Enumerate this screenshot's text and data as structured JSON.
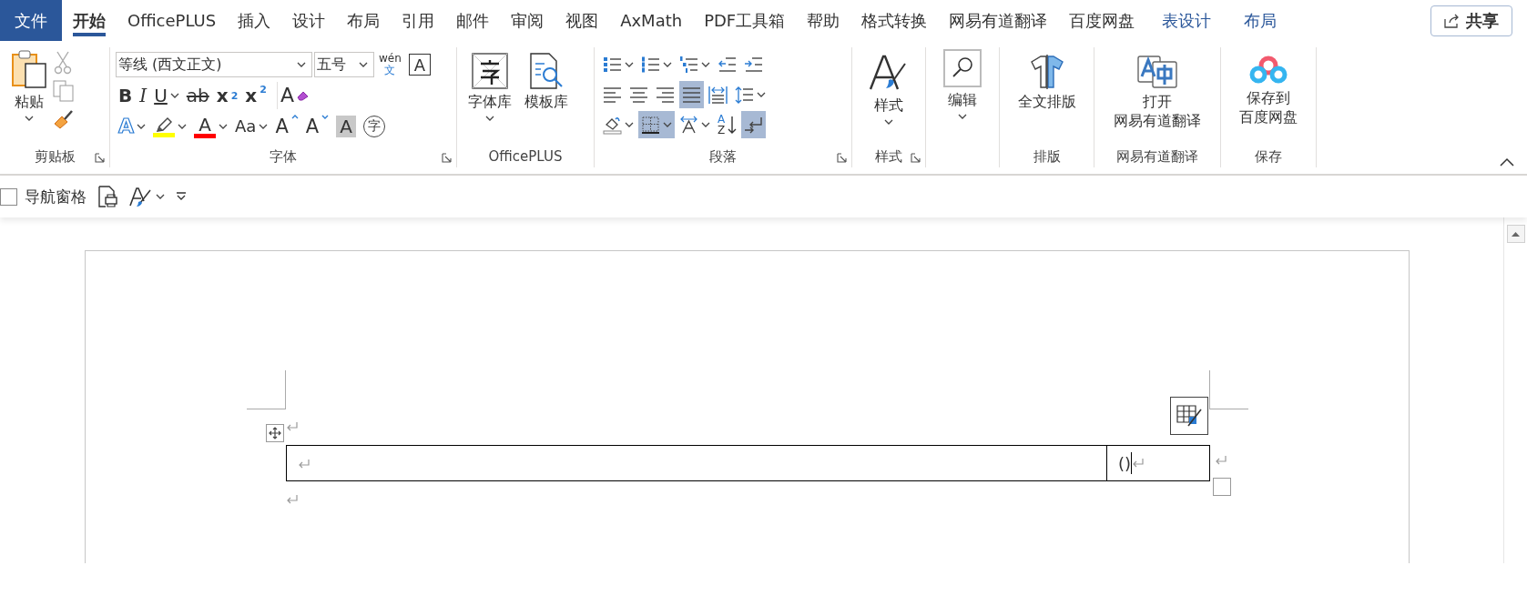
{
  "tabs": [
    {
      "label": "文件",
      "kind": "file",
      "selected": false
    },
    {
      "label": "开始",
      "kind": "main",
      "selected": true
    },
    {
      "label": "OfficePLUS",
      "kind": "main",
      "selected": false
    },
    {
      "label": "插入",
      "kind": "main",
      "selected": false
    },
    {
      "label": "设计",
      "kind": "main",
      "selected": false
    },
    {
      "label": "布局",
      "kind": "main",
      "selected": false
    },
    {
      "label": "引用",
      "kind": "main",
      "selected": false
    },
    {
      "label": "邮件",
      "kind": "main",
      "selected": false
    },
    {
      "label": "审阅",
      "kind": "main",
      "selected": false
    },
    {
      "label": "视图",
      "kind": "main",
      "selected": false
    },
    {
      "label": "AxMath",
      "kind": "main",
      "selected": false
    },
    {
      "label": "PDF工具箱",
      "kind": "main",
      "selected": false
    },
    {
      "label": "帮助",
      "kind": "main",
      "selected": false
    },
    {
      "label": "格式转换",
      "kind": "main",
      "selected": false
    },
    {
      "label": "网易有道翻译",
      "kind": "main",
      "selected": false
    },
    {
      "label": "百度网盘",
      "kind": "main",
      "selected": false
    },
    {
      "label": "表设计",
      "kind": "context",
      "selected": false
    },
    {
      "label": "布局",
      "kind": "context",
      "selected": false
    }
  ],
  "share_button": {
    "label": "共享"
  },
  "clipboard": {
    "paste": "粘贴",
    "label": "剪贴板"
  },
  "font": {
    "name": "等线 (西文正文)",
    "size": "五号",
    "phonetic_top": "wén",
    "phonetic_bottom": "文",
    "border_glyph": "A",
    "clear_glyph": "A",
    "label": "字体",
    "format_buttons": [
      {
        "glyph": "B",
        "kind": "bold",
        "dropdown": false
      },
      {
        "glyph": "I",
        "kind": "italic",
        "dropdown": false
      },
      {
        "glyph": "U",
        "kind": "underline",
        "dropdown": true
      },
      {
        "glyph": "ab",
        "kind": "strike",
        "dropdown": false
      },
      {
        "glyph": "x",
        "mark": "2",
        "kind": "subscript",
        "dropdown": false
      },
      {
        "glyph": "x",
        "mark": "2",
        "kind": "superscript",
        "dropdown": false
      }
    ],
    "color_buttons": [
      {
        "glyph": "A",
        "kind": "effects",
        "dropdown": true
      },
      {
        "kind": "highlight",
        "color": "#ffff00",
        "dropdown": true
      },
      {
        "glyph": "A",
        "kind": "font-color",
        "color": "#ff0000",
        "dropdown": true
      },
      {
        "glyph": "Aa",
        "kind": "case",
        "dropdown": true
      },
      {
        "glyph": "A",
        "kind": "grow",
        "dropdown": false
      },
      {
        "glyph": "A",
        "kind": "shrink",
        "dropdown": false
      },
      {
        "glyph": "A",
        "kind": "shading",
        "dropdown": false
      },
      {
        "glyph": "字",
        "kind": "enclose",
        "dropdown": false
      }
    ]
  },
  "officeplus": {
    "label": "OfficePLUS",
    "buttons": [
      {
        "label": "字体库",
        "kind": "font-library",
        "dropdown": true
      },
      {
        "label": "模板库",
        "kind": "template-library",
        "dropdown": false
      }
    ]
  },
  "paragraph": {
    "label": "段落",
    "rows": [
      [
        {
          "kind": "bullets",
          "dropdown": true,
          "selected": false
        },
        {
          "kind": "numbering",
          "dropdown": true,
          "selected": false
        },
        {
          "kind": "multilevel",
          "dropdown": true,
          "selected": false
        },
        {
          "kind": "decrease-indent",
          "dropdown": false,
          "selected": false
        },
        {
          "kind": "increase-indent",
          "dropdown": false,
          "selected": false
        }
      ],
      [
        {
          "kind": "align-left",
          "dropdown": false,
          "selected": false
        },
        {
          "kind": "center",
          "dropdown": false,
          "selected": false
        },
        {
          "kind": "align-right",
          "dropdown": false,
          "selected": false
        },
        {
          "kind": "justify",
          "dropdown": false,
          "selected": true
        },
        {
          "kind": "distributed",
          "dropdown": false,
          "selected": false
        },
        {
          "kind": "line-spacing",
          "dropdown": true,
          "selected": false
        }
      ],
      [
        {
          "kind": "shading",
          "dropdown": true,
          "selected": false
        },
        {
          "kind": "borders",
          "dropdown": true,
          "selected": true
        },
        {
          "kind": "asian-layout",
          "dropdown": true,
          "selected": false
        },
        {
          "kind": "sort",
          "glyph": "A",
          "mark": "Z",
          "dropdown": false,
          "selected": false
        },
        {
          "kind": "show-marks",
          "dropdown": false,
          "selected": true
        }
      ]
    ]
  },
  "styles": {
    "button": "样式",
    "label": "样式"
  },
  "editing": {
    "button": "编辑"
  },
  "layout": {
    "button": "全文排版",
    "label": "排版"
  },
  "youdao": {
    "button": [
      "打开",
      "网易有道翻译"
    ],
    "label": "网易有道翻译"
  },
  "save": {
    "button": [
      "保存到",
      "百度网盘"
    ],
    "label": "保存"
  },
  "quick_bar": {
    "nav_pane": {
      "label": "导航窗格",
      "checked": false
    }
  },
  "document": {
    "table": {
      "rows": [
        {
          "cells": [
            {
              "kind": "empty"
            },
            {
              "kind": "text",
              "text": "()",
              "caret": true
            }
          ]
        }
      ]
    }
  }
}
